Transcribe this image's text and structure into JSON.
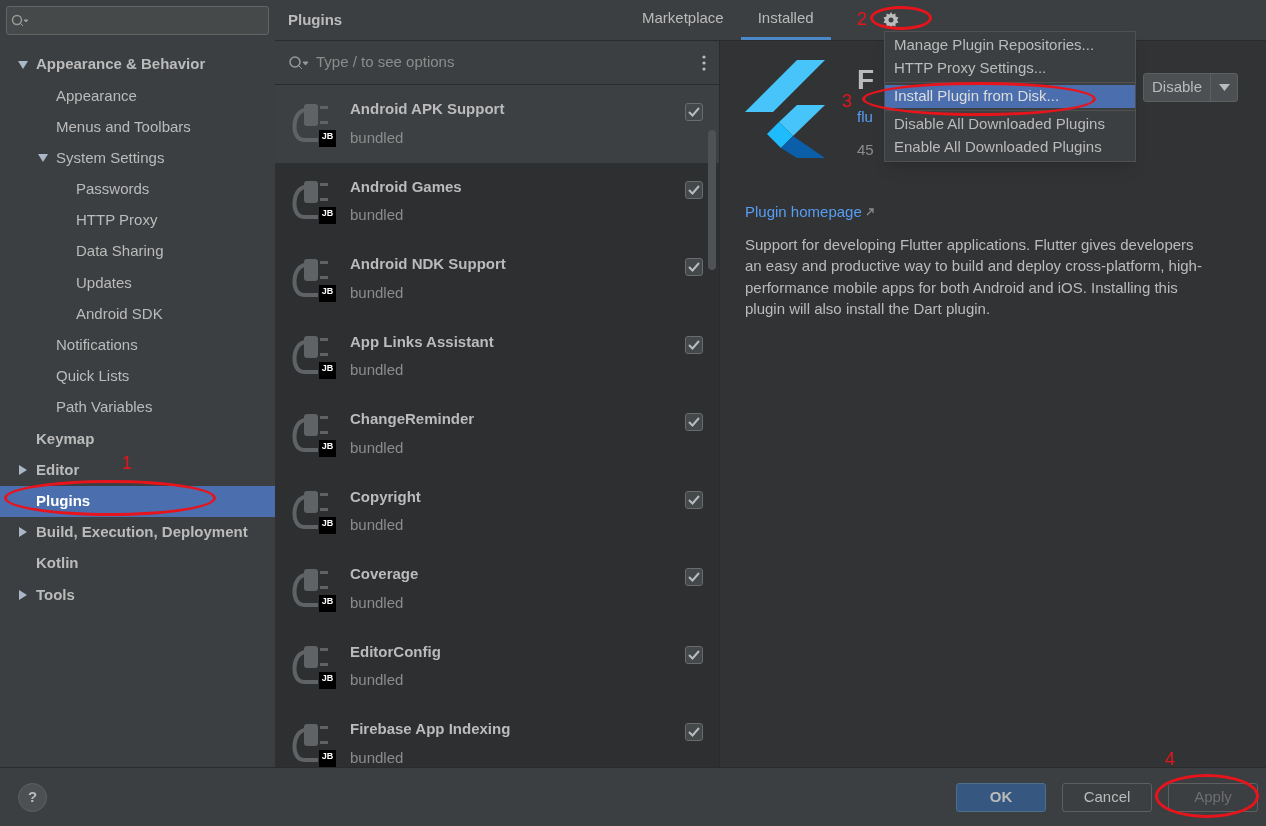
{
  "sidebar": {
    "items": [
      {
        "label": "Appearance & Behavior",
        "expanded": true,
        "selected": false,
        "children": [
          {
            "label": "Appearance",
            "selected": false
          },
          {
            "label": "Menus and Toolbars",
            "selected": false
          },
          {
            "label": "System Settings",
            "expanded": true,
            "selected": false,
            "children": [
              {
                "label": "Passwords",
                "selected": false
              },
              {
                "label": "HTTP Proxy",
                "selected": false
              },
              {
                "label": "Data Sharing",
                "selected": false
              },
              {
                "label": "Updates",
                "selected": false
              },
              {
                "label": "Android SDK",
                "selected": false
              }
            ]
          },
          {
            "label": "Notifications",
            "selected": false
          },
          {
            "label": "Quick Lists",
            "selected": false
          },
          {
            "label": "Path Variables",
            "selected": false
          }
        ]
      },
      {
        "label": "Keymap",
        "selected": false
      },
      {
        "label": "Editor",
        "expanded": false,
        "selected": false
      },
      {
        "label": "Plugins",
        "selected": true
      },
      {
        "label": "Build, Execution, Deployment",
        "expanded": false,
        "selected": false
      },
      {
        "label": "Kotlin",
        "selected": false
      },
      {
        "label": "Tools",
        "expanded": false,
        "selected": false
      }
    ]
  },
  "header": {
    "title": "Plugins",
    "tabs": [
      {
        "label": "Marketplace",
        "selected": false
      },
      {
        "label": "Installed",
        "selected": true
      }
    ]
  },
  "plugin_search": {
    "placeholder": "Type / to see options"
  },
  "plugins": [
    {
      "name": "Android APK Support",
      "source": "bundled",
      "badge": "JB",
      "checked": true,
      "selected": true
    },
    {
      "name": "Android Games",
      "source": "bundled",
      "badge": "JB",
      "checked": true,
      "selected": false
    },
    {
      "name": "Android NDK Support",
      "source": "bundled",
      "badge": "JB",
      "checked": true,
      "selected": false
    },
    {
      "name": "App Links Assistant",
      "source": "bundled",
      "badge": "JB",
      "checked": true,
      "selected": false
    },
    {
      "name": "ChangeReminder",
      "source": "bundled",
      "badge": "JB",
      "checked": true,
      "selected": false
    },
    {
      "name": "Copyright",
      "source": "bundled",
      "badge": "JB",
      "checked": true,
      "selected": false
    },
    {
      "name": "Coverage",
      "source": "bundled",
      "badge": "JB",
      "checked": true,
      "selected": false
    },
    {
      "name": "EditorConfig",
      "source": "bundled",
      "badge": "JB",
      "checked": true,
      "selected": false
    },
    {
      "name": "Firebase App Indexing",
      "source": "bundled",
      "badge": "JB",
      "checked": true,
      "selected": false
    }
  ],
  "detail": {
    "title": "F",
    "vendor_link": "flu",
    "version": "45",
    "disable_button": "Disable",
    "homepage_link": "Plugin homepage",
    "description": "Support for developing Flutter applications. Flutter gives developers an easy and productive way to build and deploy cross-platform, high-performance mobile apps for both Android and iOS. Installing this plugin will also install the Dart plugin."
  },
  "gear_menu": [
    {
      "label": "Manage Plugin Repositories...",
      "selected": false
    },
    {
      "label": "HTTP Proxy Settings...",
      "selected": false
    },
    {
      "kind": "separator"
    },
    {
      "label": "Install Plugin from Disk...",
      "selected": true
    },
    {
      "kind": "separator"
    },
    {
      "label": "Disable All Downloaded Plugins",
      "selected": false
    },
    {
      "label": "Enable All Downloaded Plugins",
      "selected": false
    }
  ],
  "footer": {
    "help": "?",
    "buttons": [
      {
        "label": "OK",
        "kind": "primary",
        "disabled": false
      },
      {
        "label": "Cancel",
        "kind": "normal",
        "disabled": false
      },
      {
        "label": "Apply",
        "kind": "normal",
        "disabled": true
      }
    ]
  },
  "annotations": [
    {
      "label": "1"
    },
    {
      "label": "2"
    },
    {
      "label": "3"
    },
    {
      "label": "4"
    }
  ]
}
